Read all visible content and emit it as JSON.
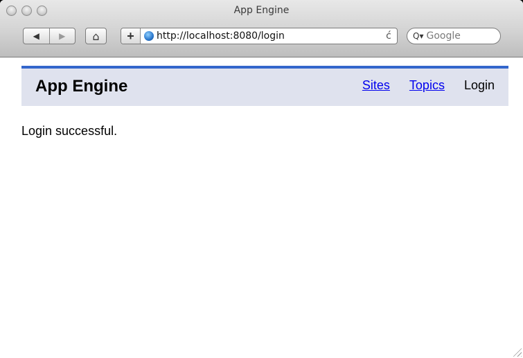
{
  "window": {
    "title": "App Engine"
  },
  "toolbar": {
    "back_icon": "◀",
    "forward_icon": "▶",
    "home_icon": "⌂",
    "add_bookmark_icon": "+",
    "url": "http://localhost:8080/login",
    "reload_icon": "ć",
    "search_icon": "Q▾",
    "search_placeholder": "Google"
  },
  "site": {
    "title": "App Engine",
    "nav": {
      "sites": "Sites",
      "topics": "Topics",
      "login": "Login"
    }
  },
  "main": {
    "message": "Login successful."
  },
  "colors": {
    "header_bar": "#3366cc",
    "header_bg": "#dfe2ee",
    "link": "#0000ee"
  }
}
